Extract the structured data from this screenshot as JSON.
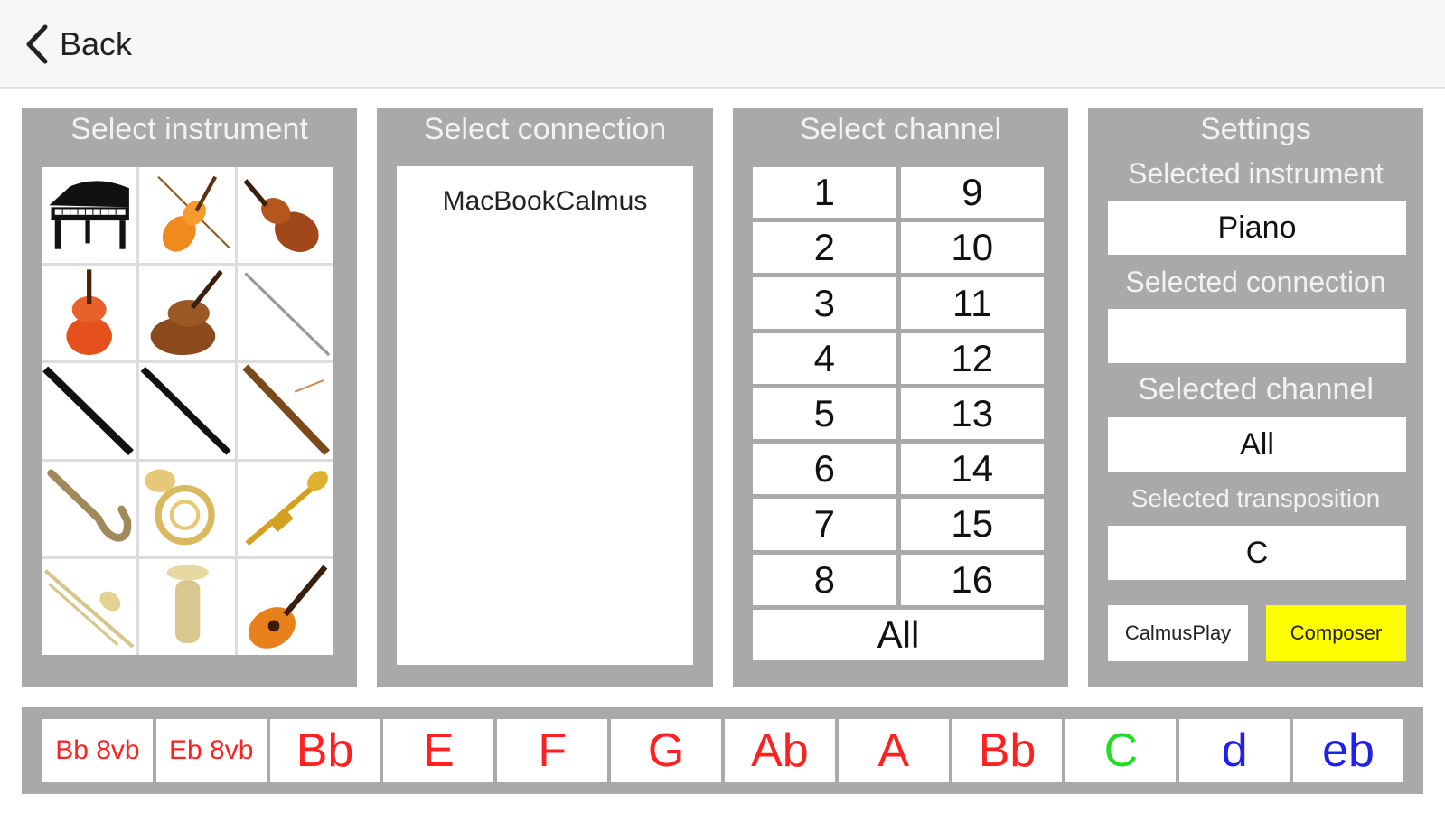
{
  "nav": {
    "back_label": "Back"
  },
  "instrument_panel": {
    "title": "Select instrument",
    "instruments": [
      {
        "icon": "piano-icon"
      },
      {
        "icon": "violin-bow-icon"
      },
      {
        "icon": "violin-icon"
      },
      {
        "icon": "viola-icon"
      },
      {
        "icon": "cello-icon"
      },
      {
        "icon": "flute-icon"
      },
      {
        "icon": "clarinet-icon"
      },
      {
        "icon": "oboe-icon"
      },
      {
        "icon": "bassoon-icon"
      },
      {
        "icon": "saxophone-icon"
      },
      {
        "icon": "french-horn-icon"
      },
      {
        "icon": "trumpet-icon"
      },
      {
        "icon": "trombone-icon"
      },
      {
        "icon": "tuba-icon"
      },
      {
        "icon": "guitar-icon"
      }
    ]
  },
  "connection_panel": {
    "title": "Select connection",
    "connections": [
      "MacBookCalmus"
    ]
  },
  "channel_panel": {
    "title": "Select channel",
    "left": [
      "1",
      "2",
      "3",
      "4",
      "5",
      "6",
      "7",
      "8"
    ],
    "right": [
      "9",
      "10",
      "11",
      "12",
      "13",
      "14",
      "15",
      "16"
    ],
    "all_label": "All"
  },
  "settings_panel": {
    "title": "Settings",
    "instrument_label": "Selected instrument",
    "instrument_value": "Piano",
    "connection_label": "Selected connection",
    "connection_value": "",
    "channel_label": "Selected channel",
    "channel_value": "All",
    "transposition_label": "Selected transposition",
    "transposition_value": "C",
    "calmusplay_label": "CalmusPlay",
    "composer_label": "Composer",
    "composer_color": "#ffff00"
  },
  "transposition_bar": {
    "buttons": [
      {
        "label": "Bb 8vb",
        "color": "#ff2020",
        "size": "small"
      },
      {
        "label": "Eb 8vb",
        "color": "#ff2020",
        "size": "small"
      },
      {
        "label": "Bb",
        "color": "#ff2020"
      },
      {
        "label": "E",
        "color": "#ff2020"
      },
      {
        "label": "F",
        "color": "#ff2020"
      },
      {
        "label": "G",
        "color": "#ff2020"
      },
      {
        "label": "Ab",
        "color": "#ff2020"
      },
      {
        "label": "A",
        "color": "#ff2020"
      },
      {
        "label": "Bb",
        "color": "#ff2020"
      },
      {
        "label": "C",
        "color": "#22dd22"
      },
      {
        "label": "d",
        "color": "#2020ee"
      },
      {
        "label": "eb",
        "color": "#2020ee"
      }
    ]
  }
}
